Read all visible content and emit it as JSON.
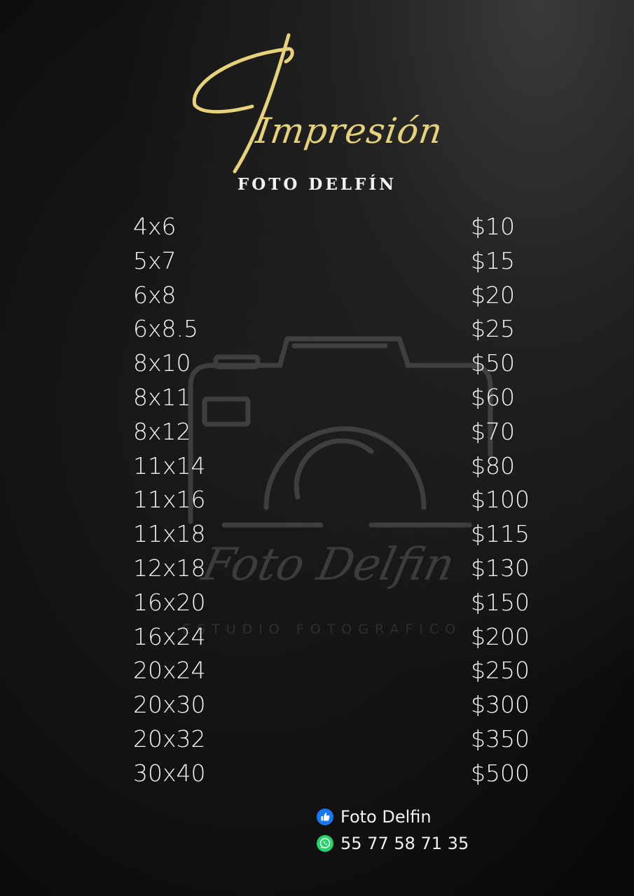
{
  "header": {
    "title": "Impresión",
    "subtitle": "FOTO DELFÍN"
  },
  "watermark": {
    "script_text": "Foto Delfin",
    "tagline": "ESTUDIO FOTOGRAFICO"
  },
  "price_list": [
    {
      "size": "4x6",
      "price": "$10"
    },
    {
      "size": "5x7",
      "price": "$15"
    },
    {
      "size": "6x8",
      "price": "$20"
    },
    {
      "size": "6x8.5",
      "price": "$25"
    },
    {
      "size": "8x10",
      "price": "$50"
    },
    {
      "size": "8x11",
      "price": "$60"
    },
    {
      "size": "8x12",
      "price": "$70"
    },
    {
      "size": "11x14",
      "price": "$80"
    },
    {
      "size": "11x16",
      "price": "$100"
    },
    {
      "size": "11x18",
      "price": "$115"
    },
    {
      "size": "12x18",
      "price": "$130"
    },
    {
      "size": "16x20",
      "price": "$150"
    },
    {
      "size": "16x24",
      "price": "$200"
    },
    {
      "size": "20x24",
      "price": "$250"
    },
    {
      "size": "20x30",
      "price": "$300"
    },
    {
      "size": "20x32",
      "price": "$350"
    },
    {
      "size": "30x40",
      "price": "$500"
    }
  ],
  "contact": {
    "facebook": {
      "icon": "facebook-like-icon",
      "label": "Foto Delfin"
    },
    "whatsapp": {
      "icon": "whatsapp-icon",
      "label": "55 77 58 71 35"
    }
  },
  "colors": {
    "background": "#0b0b0b",
    "title_gold": "#e6d27a",
    "text": "#f4f4f4",
    "facebook_blue": "#1877f2",
    "whatsapp_green": "#25d366"
  }
}
